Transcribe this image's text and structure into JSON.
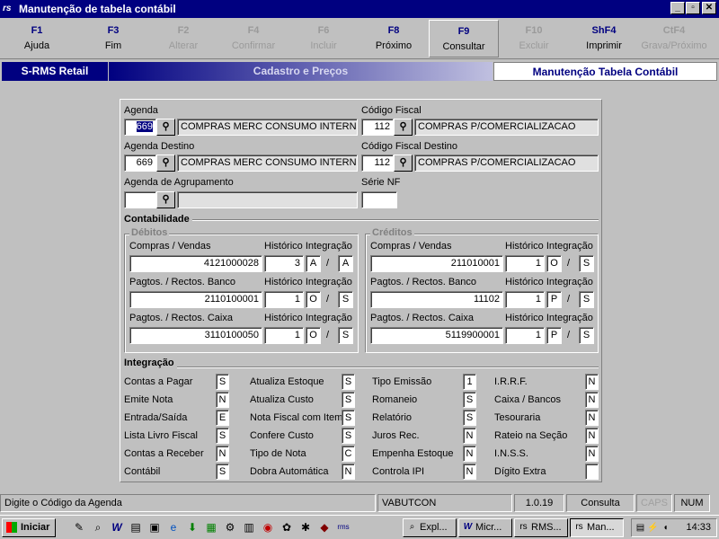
{
  "window": {
    "title": "Manutenção de tabela contábil",
    "min": "_",
    "max": "▫",
    "close": "✕"
  },
  "fkeys": [
    {
      "key": "F1",
      "label": "Ajuda",
      "enabled": true
    },
    {
      "key": "F3",
      "label": "Fim",
      "enabled": true
    },
    {
      "key": "F2",
      "label": "Alterar",
      "enabled": false
    },
    {
      "key": "F4",
      "label": "Confirmar",
      "enabled": false
    },
    {
      "key": "F6",
      "label": "Incluir",
      "enabled": false
    },
    {
      "key": "F8",
      "label": "Próximo",
      "enabled": true
    },
    {
      "key": "F9",
      "label": "Consultar",
      "enabled": true
    },
    {
      "key": "F10",
      "label": "Excluir",
      "enabled": false
    },
    {
      "key": "ShF4",
      "label": "Imprimir",
      "enabled": true
    },
    {
      "key": "CtF4",
      "label": "Grava/Próximo",
      "enabled": false
    }
  ],
  "banner": {
    "app": "S-RMS Retail",
    "module": "Cadastro e Preços",
    "screen": "Manutenção Tabela Contábil"
  },
  "form": {
    "agenda": {
      "label": "Agenda",
      "code": "669",
      "desc": "COMPRAS MERC CONSUMO INTERNO"
    },
    "codigo_fiscal": {
      "label": "Código Fiscal",
      "code": "112",
      "desc": "COMPRAS P/COMERCIALIZACAO"
    },
    "agenda_destino": {
      "label": "Agenda Destino",
      "code": "669",
      "desc": "COMPRAS MERC CONSUMO INTERNO"
    },
    "codigo_fiscal_destino": {
      "label": "Código Fiscal Destino",
      "code": "112",
      "desc": "COMPRAS P/COMERCIALIZACAO"
    },
    "agenda_agrupamento": {
      "label": "Agenda de Agrupamento",
      "code": "",
      "desc": ""
    },
    "serie_nf": {
      "label": "Série NF",
      "value": ""
    }
  },
  "contabilidade": {
    "title": "Contabilidade",
    "hist_label": "Histórico Integração",
    "debitos": {
      "title": "Débitos",
      "rows": [
        {
          "label": "Compras / Vendas",
          "account": "4121000028",
          "hist": "3",
          "i1": "A",
          "i2": "A"
        },
        {
          "label": "Pagtos. / Rectos. Banco",
          "account": "2110100001",
          "hist": "1",
          "i1": "O",
          "i2": "S"
        },
        {
          "label": "Pagtos. / Rectos. Caixa",
          "account": "3110100050",
          "hist": "1",
          "i1": "O",
          "i2": "S"
        }
      ]
    },
    "creditos": {
      "title": "Créditos",
      "rows": [
        {
          "label": "Compras / Vendas",
          "account": "211010001",
          "hist": "1",
          "i1": "O",
          "i2": "S"
        },
        {
          "label": "Pagtos. / Rectos. Banco",
          "account": "11102",
          "hist": "1",
          "i1": "P",
          "i2": "S"
        },
        {
          "label": "Pagtos. / Rectos. Caixa",
          "account": "5119900001",
          "hist": "1",
          "i1": "P",
          "i2": "S"
        }
      ]
    }
  },
  "integracao": {
    "title": "Integração",
    "columns": [
      [
        {
          "label": "Contas a Pagar",
          "value": "S"
        },
        {
          "label": "Emite Nota",
          "value": "N"
        },
        {
          "label": "Entrada/Saída",
          "value": "E"
        },
        {
          "label": "Lista Livro Fiscal",
          "value": "S"
        },
        {
          "label": "Contas a Receber",
          "value": "N"
        },
        {
          "label": "Contábil",
          "value": "S"
        }
      ],
      [
        {
          "label": "Atualiza Estoque",
          "value": "S"
        },
        {
          "label": "Atualiza Custo",
          "value": "S"
        },
        {
          "label": "Nota Fiscal com Item",
          "value": "S"
        },
        {
          "label": "Confere Custo",
          "value": "S"
        },
        {
          "label": "Tipo de Nota",
          "value": "C"
        },
        {
          "label": "Dobra Automática",
          "value": "N"
        }
      ],
      [
        {
          "label": "Tipo Emissão",
          "value": "1"
        },
        {
          "label": "Romaneio",
          "value": "S"
        },
        {
          "label": "Relatório",
          "value": "S"
        },
        {
          "label": "Juros Rec.",
          "value": "N"
        },
        {
          "label": "Empenha Estoque",
          "value": "N"
        },
        {
          "label": "Controla IPI",
          "value": "N"
        }
      ],
      [
        {
          "label": "I.R.R.F.",
          "value": "N"
        },
        {
          "label": "Caixa / Bancos",
          "value": "N"
        },
        {
          "label": "Tesouraria",
          "value": "N"
        },
        {
          "label": "Rateio na Seção",
          "value": "N"
        },
        {
          "label": "I.N.S.S.",
          "value": "N"
        },
        {
          "label": "Dígito Extra",
          "value": ""
        }
      ]
    ]
  },
  "status": {
    "message": "Digite o Código da Agenda",
    "user": "VABUTCON",
    "version": "1.0.19",
    "mode": "Consulta",
    "caps": "CAPS",
    "num": "NUM"
  },
  "taskbar": {
    "start": "Iniciar",
    "clock": "14:33",
    "tasks": [
      "Expl...",
      "Micr...",
      "RMS...",
      "Man..."
    ]
  }
}
